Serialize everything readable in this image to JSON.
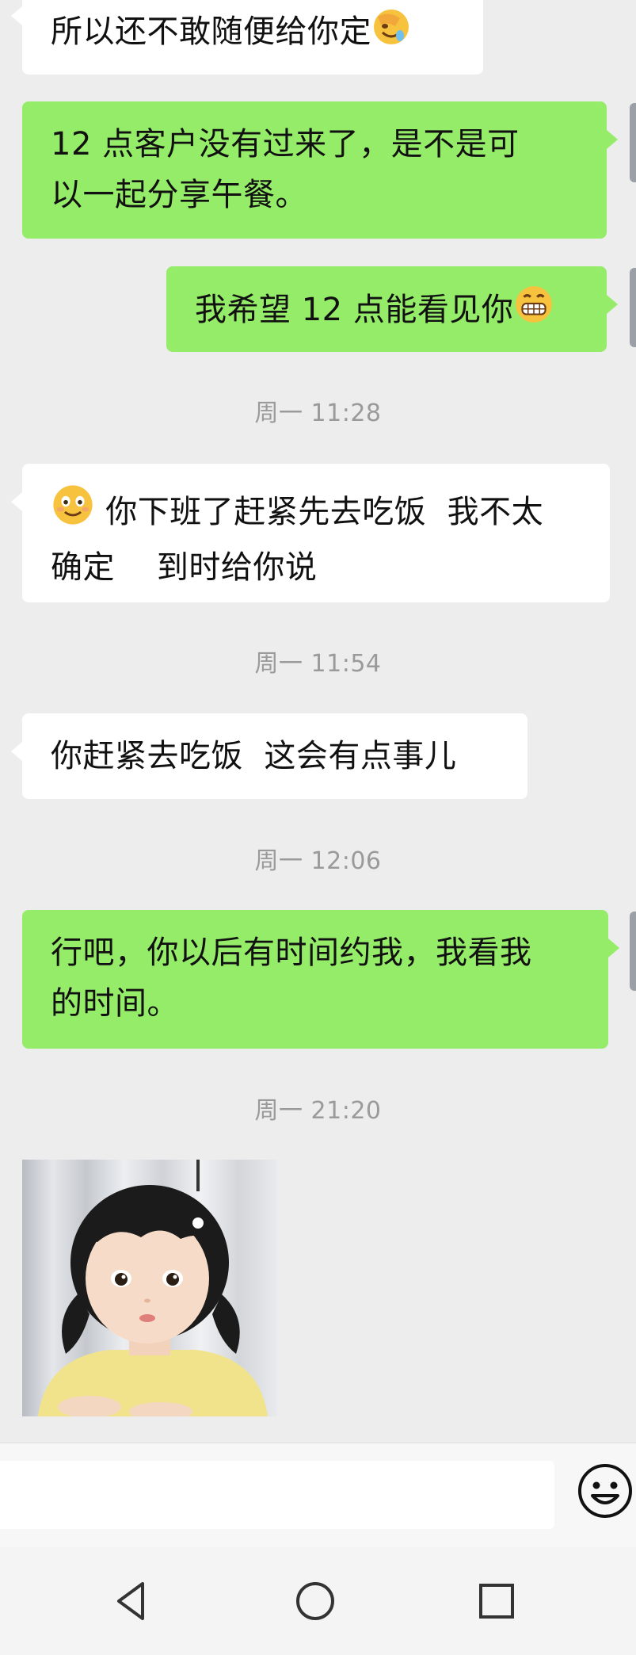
{
  "messages": [
    {
      "lines": [
        "所以还不敢随便给你定"
      ]
    },
    {
      "lines": [
        "12 点客户没有过来了，是不是可",
        "以一起分享午餐。"
      ]
    },
    {
      "lines": [
        "我希望 12 点能看见你"
      ]
    },
    {
      "lines": [
        "你下班了赶紧先去吃饭  我不太",
        "确定    到时给你说"
      ]
    },
    {
      "lines": [
        "你赶紧去吃饭  这会有点事儿"
      ]
    },
    {
      "lines": [
        "行吧，你以后有时间约我，我看我",
        "的时间。"
      ]
    }
  ],
  "timestamps": [
    "周一 11:28",
    "周一 11:54",
    "周一 12:06",
    "周一 21:20"
  ],
  "icons": {
    "facepalm": "face-palm-emoji",
    "grin": "grinning-emoji",
    "smile": "smiling-emoji",
    "emoji_button": "smiley-face-icon",
    "nav_back": "triangle-back-icon",
    "nav_home": "circle-home-icon",
    "nav_recents": "square-recents-icon"
  },
  "colors": {
    "background": "#ededed",
    "outgoing_bubble": "#95ec69",
    "incoming_bubble": "#ffffff",
    "timestamp_text": "#9a9a9a"
  }
}
